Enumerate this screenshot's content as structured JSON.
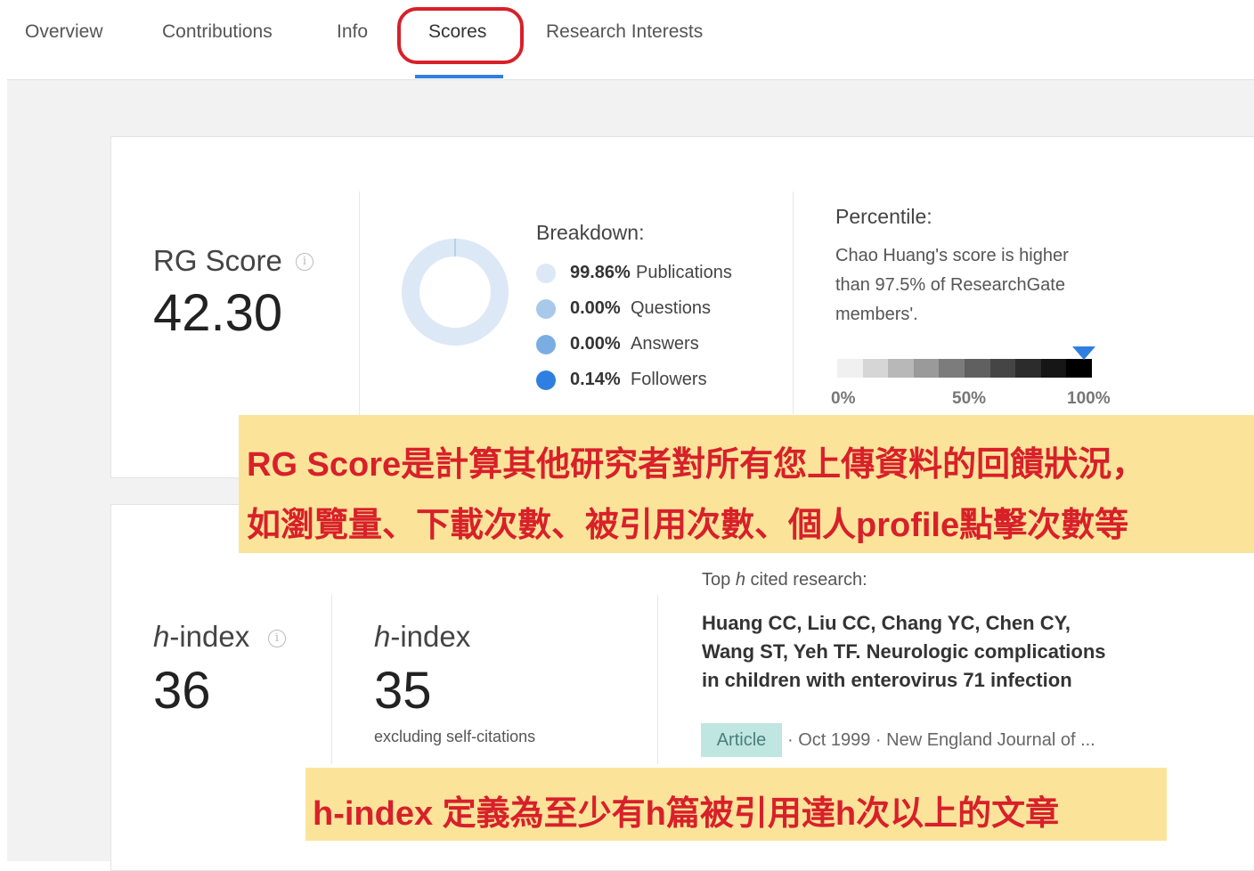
{
  "tabs": [
    {
      "label": "Overview"
    },
    {
      "label": "Contributions"
    },
    {
      "label": "Info"
    },
    {
      "label": "Scores"
    },
    {
      "label": "Research Interests"
    }
  ],
  "rg_score": {
    "label": "RG Score",
    "value": "42.30"
  },
  "breakdown": {
    "title": "Breakdown:",
    "items": [
      {
        "pct": "99.86%",
        "name": "Publications",
        "color": "#dce8f5",
        "value": 99.86
      },
      {
        "pct": "0.00%",
        "name": "Questions",
        "color": "#a9c9eb",
        "value": 0.0
      },
      {
        "pct": "0.00%",
        "name": "Answers",
        "color": "#7aaee3",
        "value": 0.0
      },
      {
        "pct": "0.14%",
        "name": "Followers",
        "color": "#2f7fe0",
        "value": 0.14
      }
    ]
  },
  "percentile": {
    "title": "Percentile:",
    "text": "Chao Huang's score is higher than 97.5% of ResearchGate members'.",
    "value": 97.5,
    "scale_labels": [
      "0%",
      "50%",
      "100%"
    ]
  },
  "banner1": {
    "line1": "RG Score是計算其他研究者對所有您上傳資料的回饋狀況，",
    "line2": "如瀏覽量、下載次數、被引用次數、個人profile點擊次數等"
  },
  "hindex": {
    "label_h": "h",
    "label_rest": "-index",
    "value": "36",
    "excl_label_h": "h",
    "excl_label_rest": "-index",
    "excl_value": "35",
    "excl_note": "excluding self-citations"
  },
  "top_cited": {
    "heading_pre": "Top ",
    "heading_h": "h",
    "heading_post": " cited research:",
    "title": "Huang CC, Liu CC, Chang YC, Chen CY, Wang ST, Yeh TF. Neurologic complications in children with enterovirus 71 infection",
    "badge": "Article",
    "meta": "· Oct 1999 · New England Journal of ..."
  },
  "banner2": {
    "text": "h-index 定義為至少有h篇被引用達h次以上的文章"
  },
  "colors": {
    "accent": "#2f7fe0",
    "annotation_red": "#d8202a",
    "annotation_yellow": "#fbe49a"
  }
}
